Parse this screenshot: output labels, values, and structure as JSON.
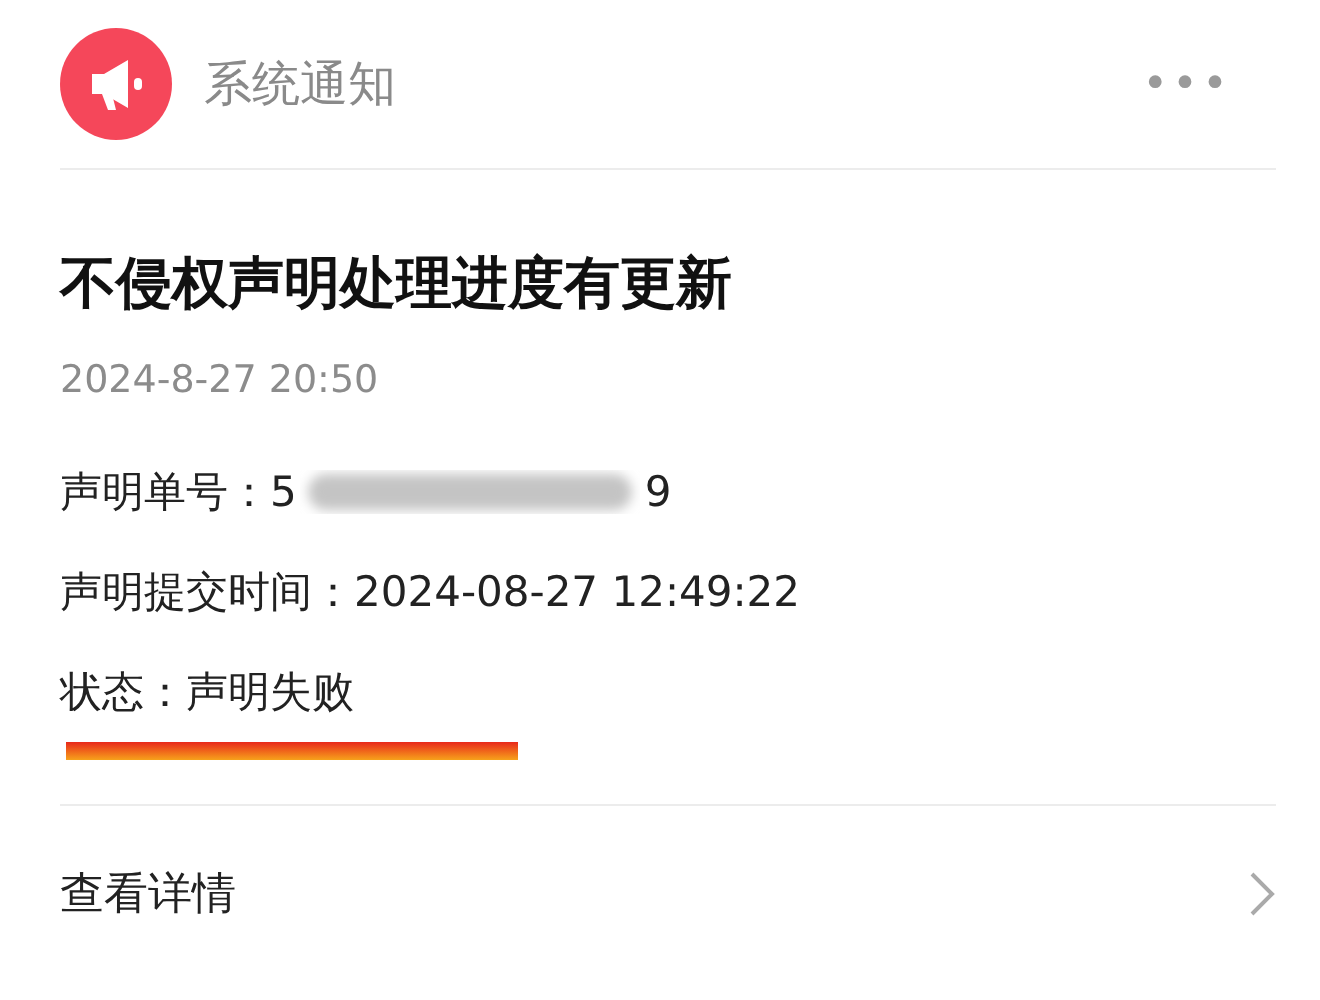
{
  "header": {
    "title": "系统通知",
    "more": "•••"
  },
  "notice": {
    "title": "不侵权声明处理进度有更新",
    "time": "2024-8-27 20:50",
    "fields": [
      {
        "kind": "redacted",
        "label": "声明单号：",
        "value_start": "5",
        "value_end": "9"
      },
      {
        "kind": "plain",
        "label": "声明提交时间：",
        "value": "2024-08-27 12:49:22"
      },
      {
        "kind": "marked",
        "label": "状态：",
        "value": "声明失败"
      }
    ]
  },
  "footer": {
    "link": "查看详情"
  }
}
